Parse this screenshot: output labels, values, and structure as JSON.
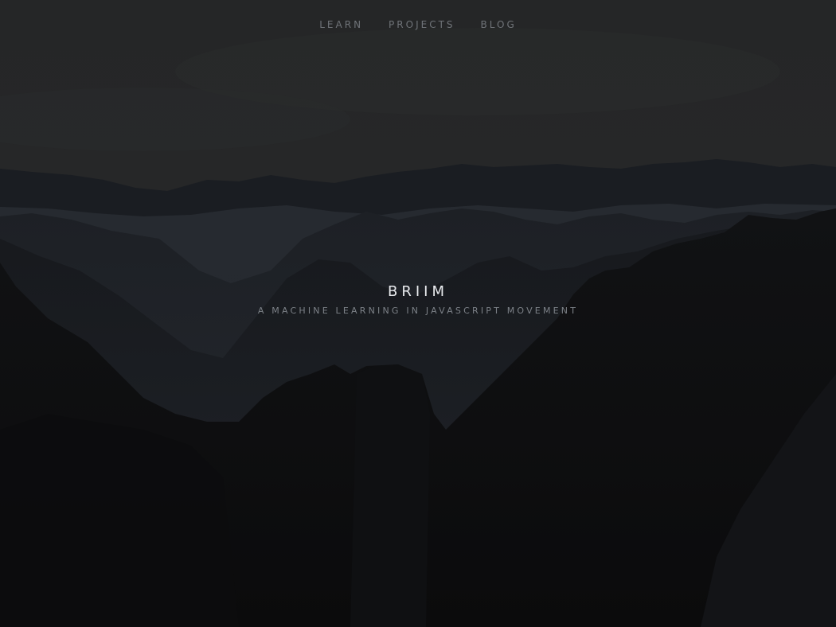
{
  "nav": {
    "items": [
      {
        "label": "LEARN"
      },
      {
        "label": "PROJECTS"
      },
      {
        "label": "BLOG"
      }
    ]
  },
  "hero": {
    "title": "BRIIM",
    "subtitle": "A MACHINE LEARNING IN JAVASCRIPT MOVEMENT",
    "background": "misty-mountain-ridges-at-dusk"
  },
  "colors": {
    "sky": "#252627",
    "foreground_rock": "#0d0d0f",
    "title_text": "#e9ebee",
    "subtitle_text": "#7c8187",
    "nav_text": "#6f7378"
  }
}
